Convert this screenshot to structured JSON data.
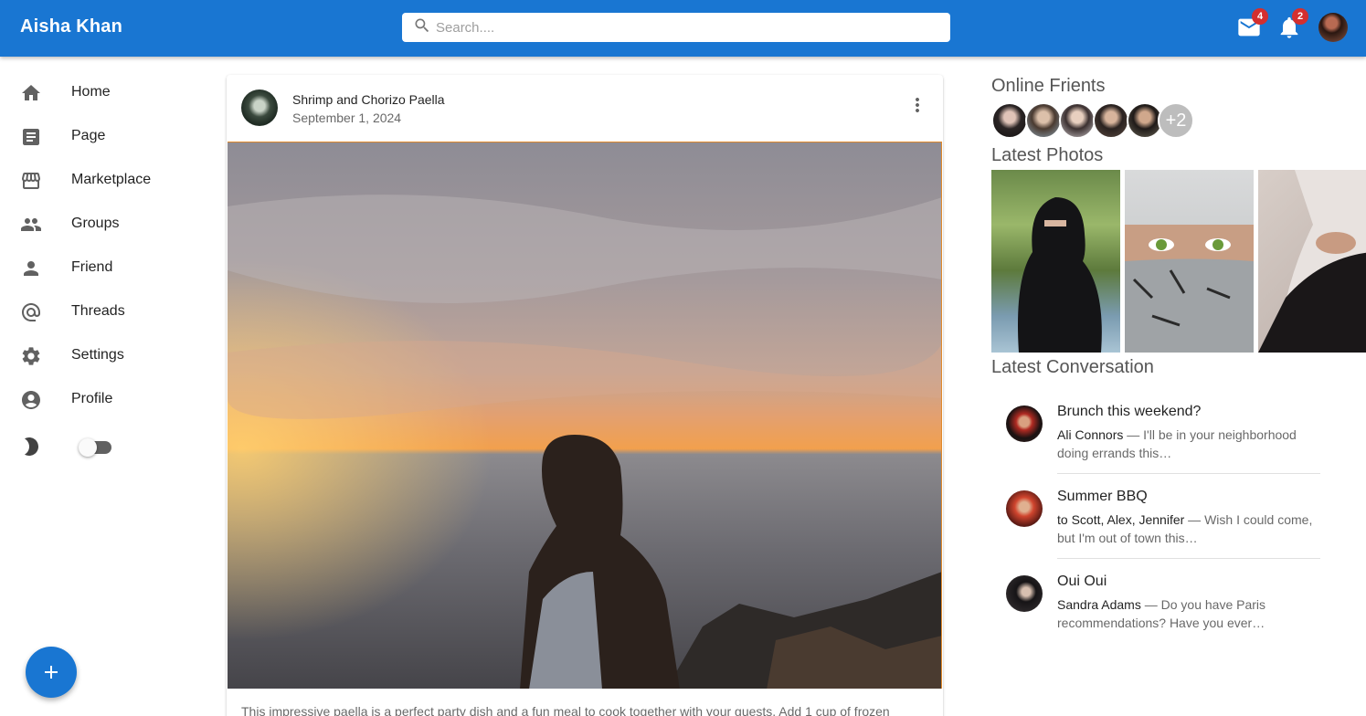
{
  "appbar": {
    "title": "Aisha Khan",
    "search_placeholder": "Search....",
    "mail_count": "4",
    "notifications_count": "2",
    "colors": {
      "primary": "#1976d2",
      "badge": "#d32f2f"
    }
  },
  "sidebar": {
    "items": [
      {
        "label": "Home",
        "icon": "home-icon"
      },
      {
        "label": "Page",
        "icon": "article-icon"
      },
      {
        "label": "Marketplace",
        "icon": "storefront-icon"
      },
      {
        "label": "Groups",
        "icon": "group-icon"
      },
      {
        "label": "Friend",
        "icon": "person-icon"
      },
      {
        "label": "Threads",
        "icon": "at-sign-icon"
      },
      {
        "label": "Settings",
        "icon": "gear-icon"
      },
      {
        "label": "Profile",
        "icon": "account-circle-icon"
      }
    ],
    "dark_mode_enabled": false
  },
  "post": {
    "title": "Shrimp and Chorizo Paella",
    "date": "September 1, 2024",
    "text": "This impressive paella is a perfect party dish and a fun meal to cook together with your guests. Add 1 cup of frozen"
  },
  "right": {
    "online_title": "Online Frients",
    "online_more": "+2",
    "photos_title": "Latest Photos",
    "conversation_title": "Latest Conversation",
    "conversations": [
      {
        "title": "Brunch this weekend?",
        "who": "Ali Connors",
        "text": " — I'll be in your neighborhood doing errands this…"
      },
      {
        "title": "Summer BBQ",
        "who": "to Scott, Alex, Jennifer",
        "text": " — Wish I could come, but I'm out of town this…"
      },
      {
        "title": "Oui Oui",
        "who": "Sandra Adams",
        "text": " — Do you have Paris recommendations? Have you ever…"
      }
    ]
  }
}
